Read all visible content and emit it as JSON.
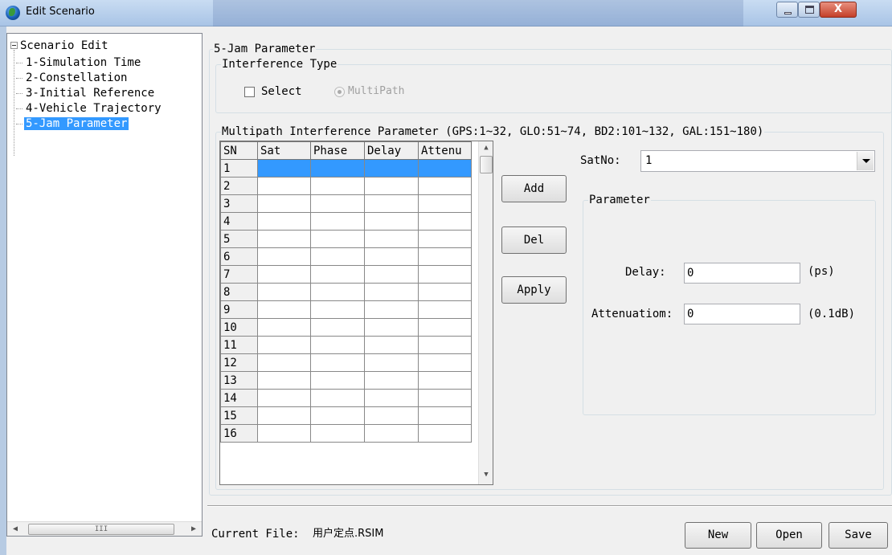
{
  "window": {
    "title": "Edit Scenario",
    "close_glyph": "X"
  },
  "tree": {
    "root": "Scenario Edit",
    "items": [
      {
        "label": "1-Simulation Time"
      },
      {
        "label": "2-Constellation"
      },
      {
        "label": "3-Initial Reference"
      },
      {
        "label": "4-Vehicle Trajectory"
      },
      {
        "label": "5-Jam Parameter",
        "selected": true
      }
    ],
    "scroll_grip": "III"
  },
  "jam": {
    "group_title": "5-Jam Parameter",
    "interference_type": {
      "title": "Interference Type",
      "select_label": "Select",
      "select_checked": false,
      "multipath_label": "MultiPath"
    },
    "multipath": {
      "title": "Multipath Interference Parameter (GPS:1~32, GLO:51~74, BD2:101~132, GAL:151~180)",
      "columns": [
        "SN",
        "Sat",
        "Phase",
        "Delay",
        "Attenu"
      ],
      "rows": [
        "1",
        "2",
        "3",
        "4",
        "5",
        "6",
        "7",
        "8",
        "9",
        "10",
        "11",
        "12",
        "13",
        "14",
        "15",
        "16"
      ],
      "selected_row": "1"
    },
    "buttons": {
      "add": "Add",
      "del": "Del",
      "apply": "Apply"
    },
    "satno": {
      "label": "SatNo:",
      "value": "1"
    },
    "parameter": {
      "title": "Parameter",
      "delay_label": "Delay:",
      "delay_value": "0",
      "delay_unit": "(ps)",
      "attenuation_label": "Attenuatiom:",
      "attenuation_value": "0",
      "attenuation_unit": "(0.1dB)"
    }
  },
  "footer": {
    "current_file_label": "Current File:",
    "current_file": "用户定点.RSIM",
    "new_label": "New",
    "open_label": "Open",
    "save_label": "Save"
  },
  "colors": {
    "selection": "#3399ff",
    "titlebar": "#b9cfe9",
    "close_button": "#c4402a"
  }
}
